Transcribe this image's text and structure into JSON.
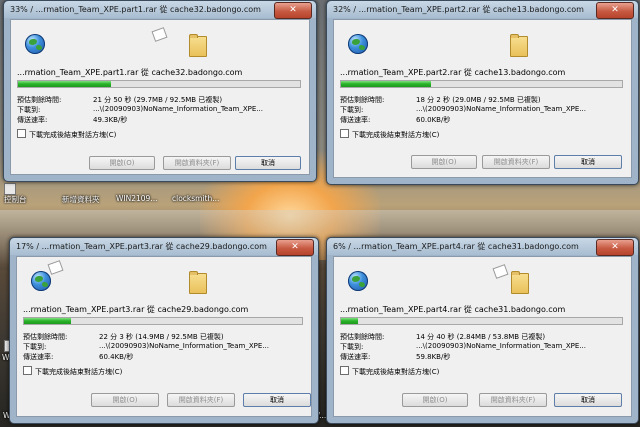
{
  "desktop": {
    "labels": [
      "控制台",
      "新增資料夾",
      "WIN2109...",
      "clocksmith...",
      "WinRar",
      "V...",
      "WinHash"
    ]
  },
  "labels": {
    "remaining": "預估剩餘時間:",
    "download_to": "下載到:",
    "speed": "傳送速率:",
    "close_on_complete": "下載完成後結束對話方塊(C)",
    "open": "開啟(O)",
    "open_folder": "開啟資料夾(F)",
    "cancel": "取消",
    "close_glyph": "✕"
  },
  "windows": [
    {
      "title": "33% / ...rmation_Team_XPE.part1.rar 從 cache32.badongo.com",
      "file": "...rmation_Team_XPE.part1.rar 從 cache32.badongo.com",
      "progress": 0.33,
      "remaining": "21 分 50 秒 (29.7MB / 92.5MB 已複製)",
      "download_to": "...\\(20090903)NoName_Information_Team_XPE...",
      "speed": "49.3KB/秒"
    },
    {
      "title": "32% / ...rmation_Team_XPE.part2.rar 從 cache13.badongo.com",
      "file": "...rmation_Team_XPE.part2.rar 從 cache13.badongo.com",
      "progress": 0.32,
      "remaining": "18 分 2 秒 (29.0MB / 92.5MB 已複製)",
      "download_to": "...\\(20090903)NoName_Information_Team_XPE...",
      "speed": "60.0KB/秒"
    },
    {
      "title": "17% / ...rmation_Team_XPE.part3.rar 從 cache29.badongo.com",
      "file": "...rmation_Team_XPE.part3.rar 從 cache29.badongo.com",
      "progress": 0.17,
      "remaining": "22 分 3 秒 (14.9MB / 92.5MB 已複製)",
      "download_to": "...\\(20090903)NoName_Information_Team_XPE...",
      "speed": "60.4KB/秒"
    },
    {
      "title": "6% / ...rmation_Team_XPE.part4.rar 從 cache31.badongo.com",
      "file": "...rmation_Team_XPE.part4.rar 從 cache31.badongo.com",
      "progress": 0.06,
      "remaining": "14 分 40 秒 (2.84MB / 53.8MB 已複製)",
      "download_to": "...\\(20090903)NoName_Information_Team_XPE...",
      "speed": "59.8KB/秒"
    }
  ]
}
